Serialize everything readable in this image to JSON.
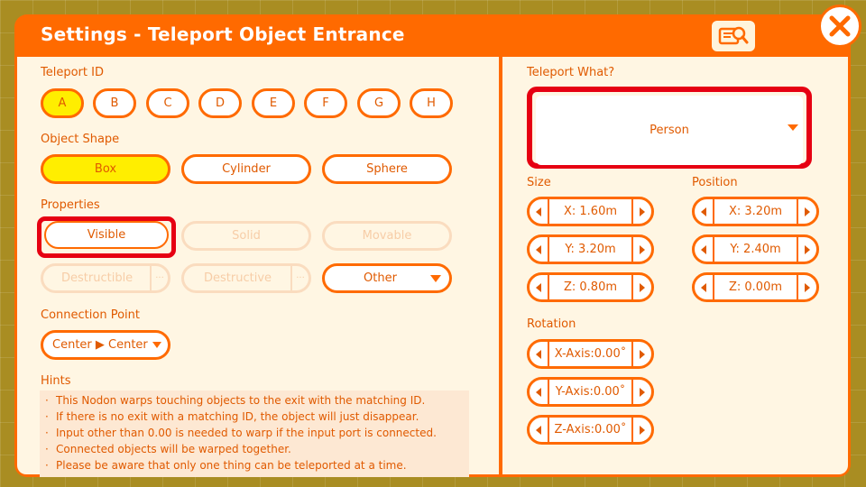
{
  "window": {
    "title": "Settings - Teleport Object Entrance"
  },
  "teleport_id": {
    "label": "Teleport ID",
    "options": [
      "A",
      "B",
      "C",
      "D",
      "E",
      "F",
      "G",
      "H"
    ],
    "selected": "A"
  },
  "object_shape": {
    "label": "Object Shape",
    "options": [
      "Box",
      "Cylinder",
      "Sphere"
    ],
    "selected": "Box"
  },
  "properties": {
    "label": "Properties",
    "visible": "Visible",
    "solid": "Solid",
    "movable": "Movable",
    "destructible": "Destructible",
    "destructive": "Destructive",
    "more": "···",
    "other": "Other"
  },
  "connection_point": {
    "label": "Connection Point",
    "value": "Center ▶ Center"
  },
  "hints": {
    "label": "Hints",
    "lines": [
      "This Nodon warps touching objects to the exit with the matching ID.",
      "If there is no exit with a matching ID, the object will just disappear.",
      "Input other than 0.00 is needed to warp if the input port is connected.",
      "Connected objects will be warped together.",
      "Please be aware that only one thing can be teleported at a time."
    ]
  },
  "teleport_what": {
    "label": "Teleport What?",
    "value": "Person"
  },
  "size": {
    "label": "Size",
    "x": "X: 1.60m",
    "y": "Y: 3.20m",
    "z": "Z: 0.80m"
  },
  "position": {
    "label": "Position",
    "x": "X: 3.20m",
    "y": "Y: 2.40m",
    "z": "Z: 0.00m"
  },
  "rotation": {
    "label": "Rotation",
    "x": "X-Axis:0.00˚",
    "y": "Y-Axis:0.00˚",
    "z": "Z-Axis:0.00˚"
  },
  "colors": {
    "accent": "#ff6a00",
    "panel": "#fff6e3",
    "selected": "#ffee00",
    "highlight": "#e60012"
  },
  "icons": {
    "help": "manual-search-icon",
    "close": "close-icon"
  }
}
